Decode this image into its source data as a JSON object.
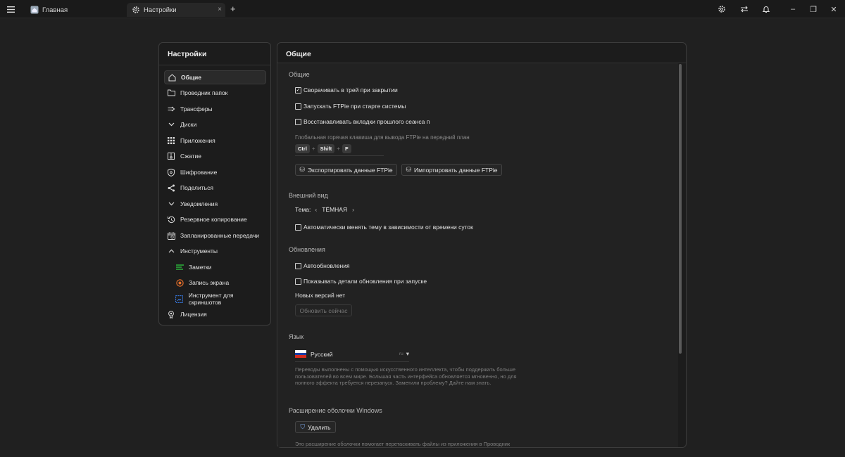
{
  "tabs": {
    "home_label": "Главная",
    "settings_label": "Настройки",
    "close_glyph": "×",
    "new_tab_glyph": "+"
  },
  "window_controls": {
    "minimize": "–",
    "restore": "❐",
    "close": "✕"
  },
  "sidebar": {
    "title": "Настройки",
    "items": [
      {
        "label": "Общие",
        "icon": "home-icon"
      },
      {
        "label": "Проводник папок",
        "icon": "folder-icon"
      },
      {
        "label": "Трансферы",
        "icon": "transfer-arrow-icon"
      },
      {
        "label": "Диски",
        "icon": "chevron-down-icon"
      },
      {
        "label": "Приложения",
        "icon": "apps-grid-icon"
      },
      {
        "label": "Сжатие",
        "icon": "archive-icon"
      },
      {
        "label": "Шифрование",
        "icon": "shield-icon"
      },
      {
        "label": "Поделиться",
        "icon": "share-icon"
      },
      {
        "label": "Уведомления",
        "icon": "chevron-down-icon"
      },
      {
        "label": "Резервное копирование",
        "icon": "backup-icon"
      },
      {
        "label": "Запланированные передачи",
        "icon": "calendar-icon"
      },
      {
        "label": "Инструменты",
        "icon": "chevron-up-icon"
      },
      {
        "label": "Заметки",
        "icon": "notes-icon"
      },
      {
        "label": "Запись экрана",
        "icon": "record-icon"
      },
      {
        "label": "Инструмент для скриншотов",
        "icon": "screenshot-icon"
      },
      {
        "label": "Лицензия",
        "icon": "license-icon"
      }
    ]
  },
  "main": {
    "title": "Общие",
    "general": {
      "heading": "Общие",
      "minimize_tray": "Сворачивать в трей при закрытии",
      "launch_startup": "Запускать FTPie при старте системы",
      "restore_tabs": "Восстанавливать вкладки прошлого сеанса п",
      "hotkey_label": "Глобальная горячая клавиша для вывода FTPie на передний план",
      "keys": [
        "Ctrl",
        "Shift",
        "F"
      ],
      "key_plus": "+",
      "export_button": "Экспортировать данные FTPie",
      "import_button": "Импортировать данные FTPie"
    },
    "appearance": {
      "heading": "Внешний вид",
      "theme_label": "Тема:",
      "theme_value": "ТЁМНАЯ",
      "prev_glyph": "‹",
      "next_glyph": "›",
      "auto_theme": "Автоматически менять тему в зависимости от времени суток"
    },
    "updates": {
      "heading": "Обновления",
      "auto_updates": "Автообновления",
      "show_details": "Показывать детали обновления при запуске",
      "status": "Новых версий нет",
      "update_button": "Обновить сейчас"
    },
    "language": {
      "heading": "Язык",
      "selected": "Русский",
      "code": "ru",
      "dropdown_glyph": "▾",
      "note": "Переводы выполнены с помощью искусственного интеллекта, чтобы поддержать больше пользователей во всем мире. Большая часть интерфейса обновляется мгновенно, но для полного эффекта требуется перезапуск. Заметили проблему? Дайте нам знать."
    },
    "shell": {
      "heading": "Расширение оболочки Windows",
      "remove_button": "Удалить",
      "note": "Это расширение оболочки помогает перетаскивать файлы из приложения в Проводник"
    }
  },
  "checkboxes": {
    "minimize_tray": true,
    "launch_startup": false,
    "restore_tabs": false,
    "auto_theme": false,
    "auto_updates": false,
    "show_details": false
  },
  "check_glyph": "✓",
  "colors": {
    "background": "#202020",
    "panel": "#1c1c1c",
    "accent_notes": "#2ecc40",
    "accent_record": "#e8702a",
    "accent_screenshot": "#3b82f6"
  }
}
